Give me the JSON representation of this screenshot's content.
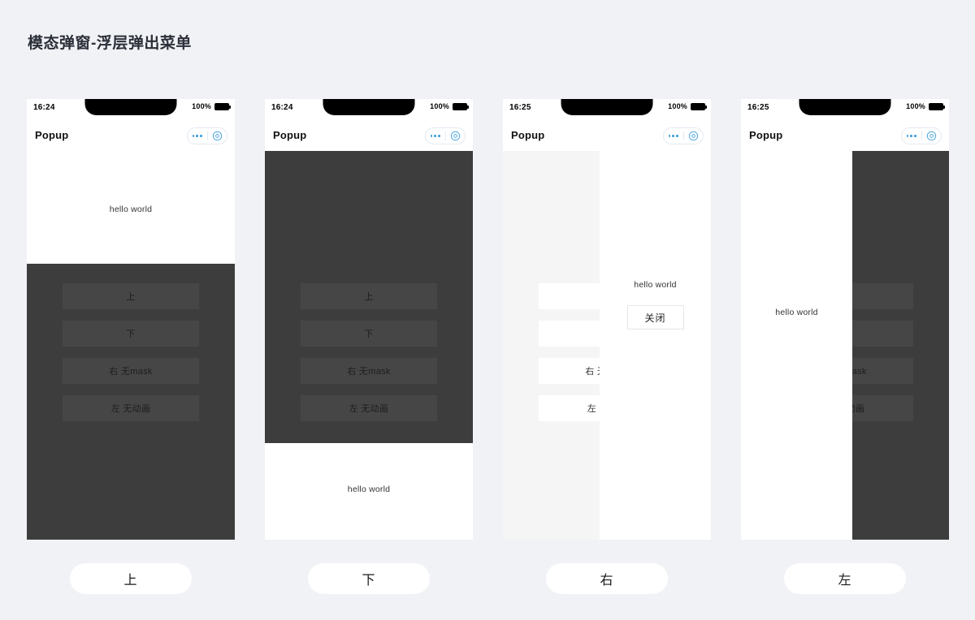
{
  "page": {
    "title": "模态弹窗-浮层弹出菜单",
    "background_color": "#f1f2f6"
  },
  "colors": {
    "mask": "#3d3d3d",
    "mask_button": "#464646",
    "panel": "#ffffff",
    "capsule_accent": "#3f9fe0",
    "caption_bg": "#ffffff"
  },
  "status_bar": {
    "time_early": "16:24",
    "time_late": "16:25",
    "battery_percent": "100%",
    "battery_icon": "battery-full-icon",
    "notch_icon": "notch"
  },
  "nav": {
    "title": "Popup",
    "more_icon": "more-dots-icon",
    "target_icon": "target-circle-icon"
  },
  "content": {
    "hello": "hello world",
    "close_label": "关闭"
  },
  "menu": {
    "items": [
      {
        "label": "上"
      },
      {
        "label": "下"
      },
      {
        "label": "右 无mask"
      },
      {
        "label": "左 无动画"
      }
    ]
  },
  "frames": [
    {
      "name": "popup-top",
      "time": "16:24",
      "caption": "上",
      "description": "mask covers lower area, menu anchored under content",
      "hello_position": "top-content"
    },
    {
      "name": "popup-bottom",
      "time": "16:24",
      "caption": "下",
      "description": "mask covers upper area, hello world sheet at bottom",
      "hello_position": "bottom-sheet"
    },
    {
      "name": "popup-right-no-mask",
      "time": "16:25",
      "caption": "右",
      "description": "no mask, white panel slides in from right",
      "hello_position": "right-panel"
    },
    {
      "name": "popup-left-no-animation",
      "time": "16:25",
      "caption": "左",
      "description": "mask on right, white panel on left, no animation",
      "hello_position": "left-panel"
    }
  ],
  "captions": [
    "上",
    "下",
    "右",
    "左"
  ]
}
